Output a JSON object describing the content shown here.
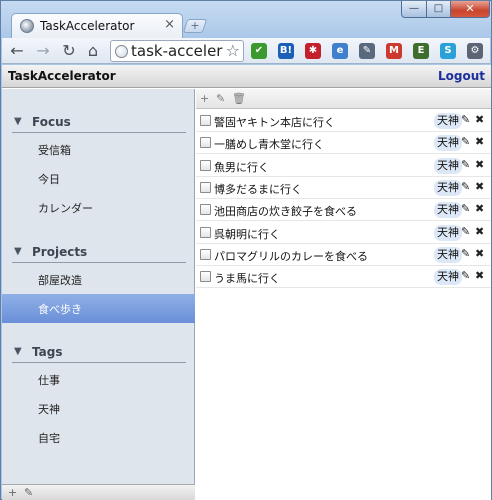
{
  "browser": {
    "tab_title": "TaskAccelerator",
    "tab_close": "×",
    "new_tab": "+",
    "window_controls": {
      "minimize": "—",
      "maximize": "□",
      "close": "✕"
    },
    "nav": {
      "back": "←",
      "forward": "→",
      "reload": "↻",
      "home": "⌂"
    },
    "omnibox_text": "task-accelerator",
    "bookmark_star": "☆",
    "extensions": [
      {
        "name": "check-extension",
        "label": "✔",
        "color": "#3a9a2e"
      },
      {
        "name": "hatena-bookmark",
        "label": "B!",
        "color": "#1b5fb8"
      },
      {
        "name": "asterisk-extension",
        "label": "✱",
        "color": "#c4202c"
      },
      {
        "name": "feed-extension",
        "label": "e",
        "color": "#3f7fcc"
      },
      {
        "name": "eyedropper-extension",
        "label": "✎",
        "color": "#5a6a7e"
      },
      {
        "name": "gmail-extension",
        "label": "M",
        "color": "#cc3a2f"
      },
      {
        "name": "evernote-extension",
        "label": "E",
        "color": "#3d6e2d"
      },
      {
        "name": "skype-extension",
        "label": "S",
        "color": "#2aa2d8"
      },
      {
        "name": "wrench-menu",
        "label": "⚙",
        "color": "#5b6575"
      }
    ]
  },
  "app": {
    "title": "TaskAccelerator",
    "logout": "Logout"
  },
  "sidebar": {
    "sections": [
      {
        "label": "Focus",
        "items": [
          "受信箱",
          "今日",
          "カレンダー"
        ]
      },
      {
        "label": "Projects",
        "items": [
          "部屋改造",
          "食べ歩き"
        ]
      },
      {
        "label": "Tags",
        "items": [
          "仕事",
          "天神",
          "自宅"
        ]
      }
    ],
    "selected_item": "食べ歩き",
    "footer": {
      "add": "+",
      "edit": "✎"
    }
  },
  "main": {
    "toolbar": {
      "add": "+",
      "edit": "✎",
      "delete": "🗑"
    },
    "tasks": [
      {
        "title": "警固ヤキトン本店に行く",
        "tag": "天神"
      },
      {
        "title": "一膳めし青木堂に行く",
        "tag": "天神"
      },
      {
        "title": "魚男に行く",
        "tag": "天神"
      },
      {
        "title": "博多だるまに行く",
        "tag": "天神"
      },
      {
        "title": "池田商店の炊き餃子を食べる",
        "tag": "天神"
      },
      {
        "title": "呉朝明に行く",
        "tag": "天神"
      },
      {
        "title": "パロマグリルのカレーを食べる",
        "tag": "天神"
      },
      {
        "title": "うま馬に行く",
        "tag": "天神"
      }
    ],
    "edit_icon": "✎",
    "delete_icon": "✖"
  }
}
